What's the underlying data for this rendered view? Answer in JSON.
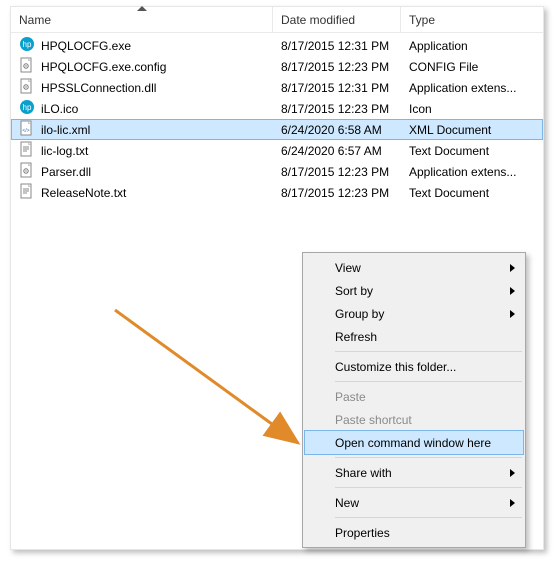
{
  "columns": {
    "name": "Name",
    "date": "Date modified",
    "type": "Type"
  },
  "files": [
    {
      "icon": "app",
      "name": "HPQLOCFG.exe",
      "date": "8/17/2015 12:31 PM",
      "type": "Application",
      "sel": false
    },
    {
      "icon": "config",
      "name": "HPQLOCFG.exe.config",
      "date": "8/17/2015 12:23 PM",
      "type": "CONFIG File",
      "sel": false
    },
    {
      "icon": "dll",
      "name": "HPSSLConnection.dll",
      "date": "8/17/2015 12:31 PM",
      "type": "Application extens...",
      "sel": false
    },
    {
      "icon": "ico",
      "name": "iLO.ico",
      "date": "8/17/2015 12:23 PM",
      "type": "Icon",
      "sel": false
    },
    {
      "icon": "xml",
      "name": "ilo-lic.xml",
      "date": "6/24/2020 6:58 AM",
      "type": "XML Document",
      "sel": true
    },
    {
      "icon": "txt",
      "name": "lic-log.txt",
      "date": "6/24/2020 6:57 AM",
      "type": "Text Document",
      "sel": false
    },
    {
      "icon": "dll",
      "name": "Parser.dll",
      "date": "8/17/2015 12:23 PM",
      "type": "Application extens...",
      "sel": false
    },
    {
      "icon": "txt",
      "name": "ReleaseNote.txt",
      "date": "8/17/2015 12:23 PM",
      "type": "Text Document",
      "sel": false
    }
  ],
  "menu": [
    {
      "kind": "item",
      "label": "View",
      "sub": true,
      "dis": false,
      "hl": false
    },
    {
      "kind": "item",
      "label": "Sort by",
      "sub": true,
      "dis": false,
      "hl": false
    },
    {
      "kind": "item",
      "label": "Group by",
      "sub": true,
      "dis": false,
      "hl": false
    },
    {
      "kind": "item",
      "label": "Refresh",
      "sub": false,
      "dis": false,
      "hl": false
    },
    {
      "kind": "sep"
    },
    {
      "kind": "item",
      "label": "Customize this folder...",
      "sub": false,
      "dis": false,
      "hl": false
    },
    {
      "kind": "sep"
    },
    {
      "kind": "item",
      "label": "Paste",
      "sub": false,
      "dis": true,
      "hl": false
    },
    {
      "kind": "item",
      "label": "Paste shortcut",
      "sub": false,
      "dis": true,
      "hl": false
    },
    {
      "kind": "item",
      "label": "Open command window here",
      "sub": false,
      "dis": false,
      "hl": true
    },
    {
      "kind": "sep"
    },
    {
      "kind": "item",
      "label": "Share with",
      "sub": true,
      "dis": false,
      "hl": false
    },
    {
      "kind": "sep"
    },
    {
      "kind": "item",
      "label": "New",
      "sub": true,
      "dis": false,
      "hl": false
    },
    {
      "kind": "sep"
    },
    {
      "kind": "item",
      "label": "Properties",
      "sub": false,
      "dis": false,
      "hl": false
    }
  ],
  "colors": {
    "accent": "#e08a2a",
    "selBg": "#cde8ff",
    "selBorder": "#7ab7e8"
  }
}
